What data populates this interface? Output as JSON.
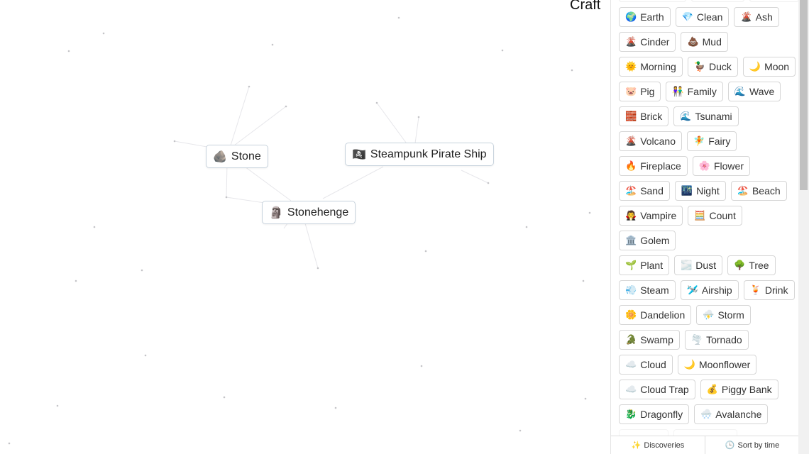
{
  "header": {
    "title": "Craft"
  },
  "canvas_nodes": [
    {
      "emoji": "🪨",
      "label": "Stone"
    },
    {
      "emoji": "🏴‍☠️",
      "label": "Steampunk Pirate Ship"
    },
    {
      "emoji": "🗿",
      "label": "Stonehenge"
    }
  ],
  "sidebar": {
    "rows": [
      [
        {
          "emoji": "",
          "label": ""
        },
        {
          "emoji": "",
          "label": ""
        },
        {
          "emoji": "",
          "label": ""
        }
      ],
      [
        {
          "emoji": "🌍",
          "label": "Earth"
        },
        {
          "emoji": "💎",
          "label": "Clean"
        },
        {
          "emoji": "🌋",
          "label": "Ash"
        }
      ],
      [
        {
          "emoji": "🌋",
          "label": "Cinder"
        },
        {
          "emoji": "💩",
          "label": "Mud"
        }
      ],
      [
        {
          "emoji": "🌞",
          "label": "Morning"
        },
        {
          "emoji": "🦆",
          "label": "Duck"
        },
        {
          "emoji": "🌙",
          "label": "Moon"
        }
      ],
      [
        {
          "emoji": "🐷",
          "label": "Pig"
        },
        {
          "emoji": "👫",
          "label": "Family"
        },
        {
          "emoji": "🌊",
          "label": "Wave"
        }
      ],
      [
        {
          "emoji": "🧱",
          "label": "Brick"
        },
        {
          "emoji": "🌊",
          "label": "Tsunami"
        }
      ],
      [
        {
          "emoji": "🌋",
          "label": "Volcano"
        },
        {
          "emoji": "🧚",
          "label": "Fairy"
        }
      ],
      [
        {
          "emoji": "🔥",
          "label": "Fireplace"
        },
        {
          "emoji": "🌸",
          "label": "Flower"
        }
      ],
      [
        {
          "emoji": "🏖️",
          "label": "Sand"
        },
        {
          "emoji": "🌃",
          "label": "Night"
        },
        {
          "emoji": "🏖️",
          "label": "Beach"
        }
      ],
      [
        {
          "emoji": "🧛",
          "label": "Vampire"
        },
        {
          "emoji": "🧮",
          "label": "Count"
        }
      ],
      [
        {
          "emoji": "🏛️",
          "label": "Golem"
        }
      ],
      [
        {
          "emoji": "🌱",
          "label": "Plant"
        },
        {
          "emoji": "🌫️",
          "label": "Dust"
        },
        {
          "emoji": "🌳",
          "label": "Tree"
        }
      ],
      [
        {
          "emoji": "💨",
          "label": "Steam"
        },
        {
          "emoji": "🛩️",
          "label": "Airship"
        },
        {
          "emoji": "🍹",
          "label": "Drink"
        }
      ],
      [
        {
          "emoji": "🌼",
          "label": "Dandelion"
        },
        {
          "emoji": "⛈️",
          "label": "Storm"
        }
      ],
      [
        {
          "emoji": "🐊",
          "label": "Swamp"
        },
        {
          "emoji": "🌪️",
          "label": "Tornado"
        }
      ],
      [
        {
          "emoji": "☁️",
          "label": "Cloud"
        },
        {
          "emoji": "🌙",
          "label": "Moonflower"
        }
      ],
      [
        {
          "emoji": "☁️",
          "label": "Cloud Trap"
        },
        {
          "emoji": "💰",
          "label": "Piggy Bank"
        }
      ],
      [
        {
          "emoji": "🐉",
          "label": "Dragonfly"
        },
        {
          "emoji": "🌨️",
          "label": "Avalanche"
        }
      ]
    ],
    "footer": {
      "discoveries": "Discoveries",
      "sort": "Sort by time"
    }
  }
}
